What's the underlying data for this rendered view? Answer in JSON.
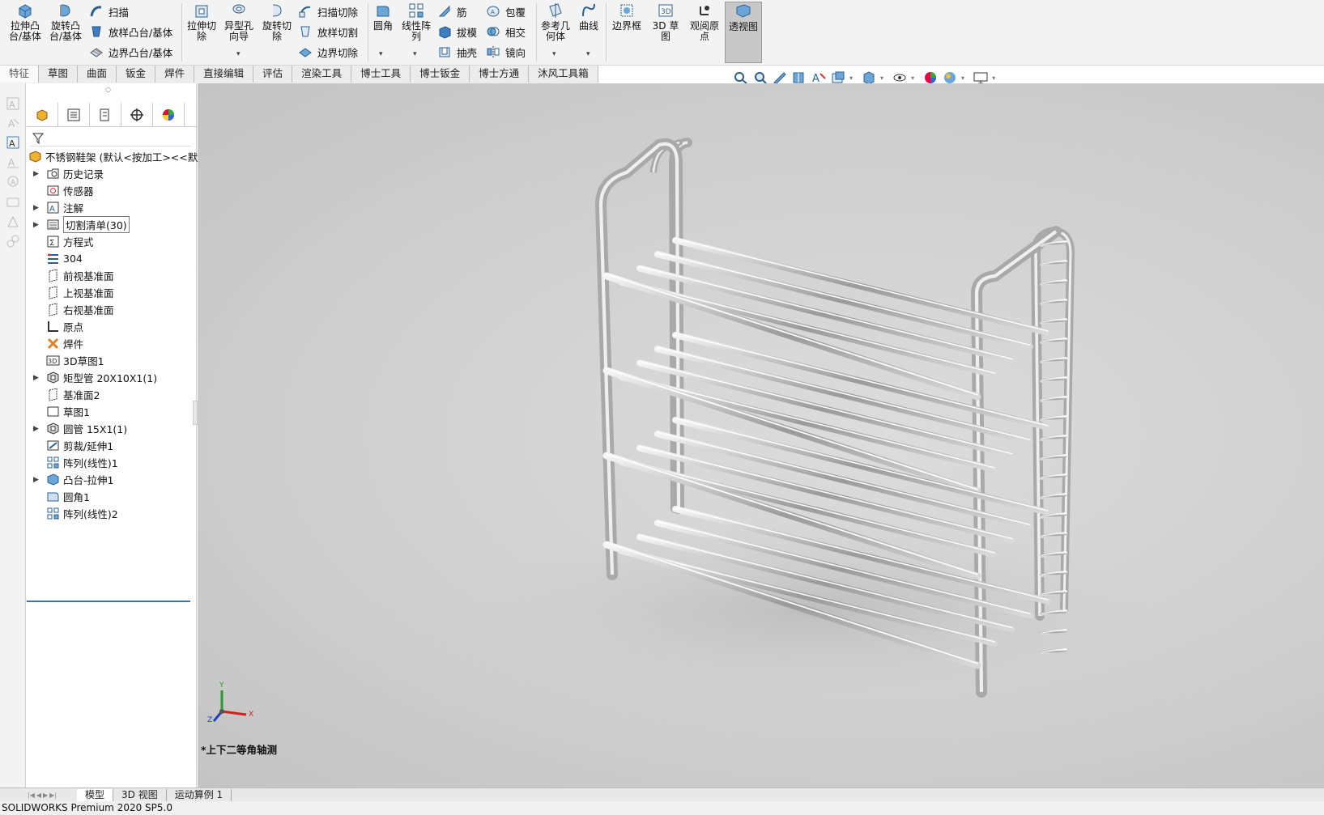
{
  "ribbon": {
    "features": {
      "extrude_boss": "拉伸凸\n台/基体",
      "revolve_boss": "旋转凸\n台/基体",
      "sweep": "扫描",
      "loft_boss": "放样凸台/基体",
      "boundary_boss": "边界凸台/基体",
      "extrude_cut": "拉伸切\n除",
      "hole_wizard": "异型孔\n向导",
      "revolve_cut": "旋转切\n除",
      "sweep_cut": "扫描切除",
      "loft_cut": "放样切割",
      "boundary_cut": "边界切除",
      "fillet": "圆角",
      "linear_pattern": "线性阵\n列",
      "rib": "筋",
      "draft": "拔模",
      "shell": "抽壳",
      "wrap": "包覆",
      "intersect": "相交",
      "mirror": "镜向",
      "ref_geometry": "参考几\n何体",
      "curves": "曲线",
      "bounding_box": "边界框",
      "sketch_3d": "3D 草图",
      "instant_origin": "观阅原\n点",
      "perspective": "透视图"
    },
    "tabs": [
      "特征",
      "草图",
      "曲面",
      "钣金",
      "焊件",
      "直接编辑",
      "评估",
      "渲染工具",
      "博士工具",
      "博士钣金",
      "博士方通",
      "沐风工具箱"
    ]
  },
  "feature_tree": {
    "root": "不锈钢鞋架 (默认<按加工><<默认",
    "items": [
      {
        "label": "历史记录",
        "expandable": true,
        "icon": "history-folder-icon"
      },
      {
        "label": "传感器",
        "expandable": false,
        "icon": "sensor-icon"
      },
      {
        "label": "注解",
        "expandable": true,
        "icon": "annotation-icon"
      },
      {
        "label": "切割清单(30)",
        "expandable": true,
        "icon": "cut-list-icon",
        "boxed": true
      },
      {
        "label": "方程式",
        "expandable": false,
        "icon": "equation-icon"
      },
      {
        "label": "304",
        "expandable": false,
        "icon": "material-icon"
      },
      {
        "label": "前视基准面",
        "expandable": false,
        "icon": "plane-icon"
      },
      {
        "label": "上视基准面",
        "expandable": false,
        "icon": "plane-icon"
      },
      {
        "label": "右视基准面",
        "expandable": false,
        "icon": "plane-icon"
      },
      {
        "label": "原点",
        "expandable": false,
        "icon": "origin-icon"
      },
      {
        "label": "焊件",
        "expandable": false,
        "icon": "weldment-icon"
      },
      {
        "label": "3D草图1",
        "expandable": false,
        "icon": "sketch3d-icon"
      },
      {
        "label": "矩型管 20X10X1(1)",
        "expandable": true,
        "icon": "structural-member-icon"
      },
      {
        "label": "基准面2",
        "expandable": false,
        "icon": "plane-icon"
      },
      {
        "label": "草图1",
        "expandable": false,
        "icon": "sketch-icon"
      },
      {
        "label": "圆管 15X1(1)",
        "expandable": true,
        "icon": "structural-member-icon"
      },
      {
        "label": "剪裁/延伸1",
        "expandable": false,
        "icon": "trim-icon"
      },
      {
        "label": "阵列(线性)1",
        "expandable": false,
        "icon": "pattern-icon"
      },
      {
        "label": "凸台-拉伸1",
        "expandable": true,
        "icon": "extrude-icon"
      },
      {
        "label": "圆角1",
        "expandable": false,
        "icon": "fillet-icon"
      },
      {
        "label": "阵列(线性)2",
        "expandable": false,
        "icon": "pattern-icon"
      }
    ]
  },
  "viewport": {
    "view_name": "*上下二等角轴测",
    "axis_labels": {
      "x": "X",
      "y": "Y",
      "z": "Z"
    }
  },
  "bottom_tabs": [
    "模型",
    "3D 视图",
    "运动算例 1"
  ],
  "status": "SOLIDWORKS Premium 2020 SP5.0"
}
